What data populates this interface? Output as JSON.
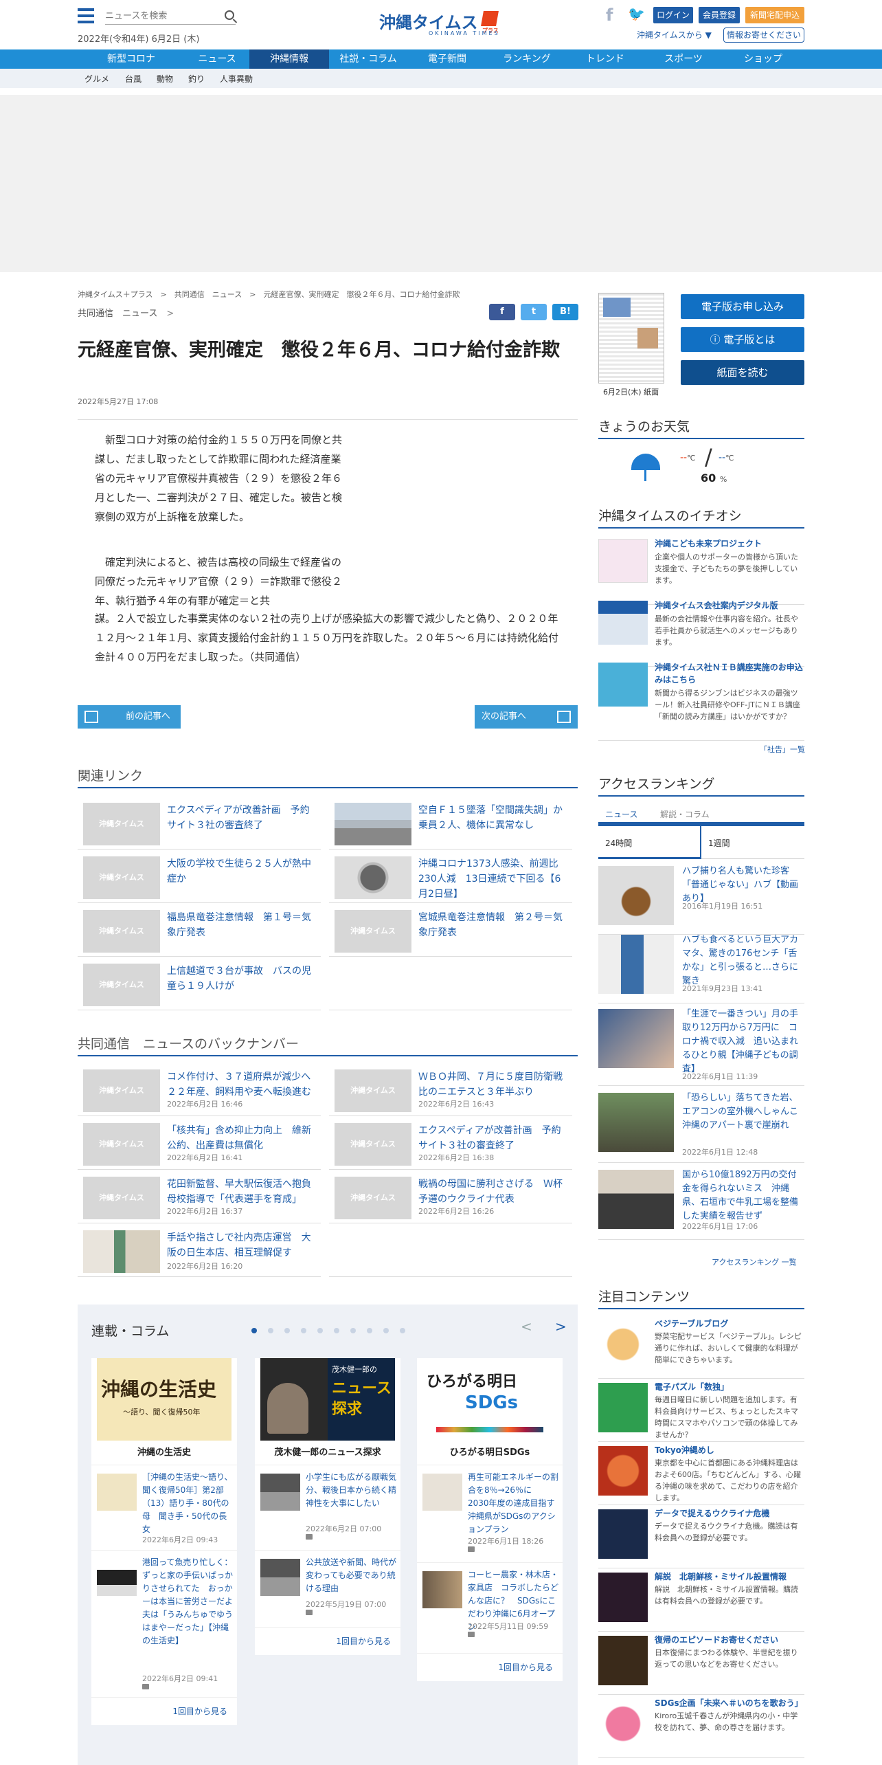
{
  "header": {
    "search_placeholder": "ニュースを検索",
    "date": "2022年(令和4年) 6月2日 (木)",
    "logo_ja": "沖縄タイムス",
    "logo_plus": "プラス",
    "logo_en": "OKINAWA TIMES",
    "login": "ログイン",
    "register": "会員登録",
    "home_delivery": "新聞宅配申込",
    "from_okinawa": "沖縄タイムスから ▼",
    "info_request": "情報お寄せください"
  },
  "nav": [
    "新型コロナ",
    "ニュース",
    "沖縄情報",
    "社説・コラム",
    "電子新聞",
    "ランキング",
    "トレンド",
    "スポーツ",
    "ショップ"
  ],
  "subnav": [
    "グルメ",
    "台風",
    "動物",
    "釣り",
    "人事異動"
  ],
  "breadcrumb": [
    "沖縄タイムス＋プラス",
    "共同通信　ニュース",
    "元経産官僚、実刑確定　懲役２年６月、コロナ給付金詐欺"
  ],
  "category": "共同通信　ニュース",
  "share": {
    "facebook": "f",
    "twitter": "t",
    "hatena": "B!"
  },
  "article": {
    "title": "元経産官僚、実刑確定　懲役２年６月、コロナ給付金詐欺",
    "date": "2022年5月27日 17:08",
    "p1": "新型コロナ対策の給付金約１５５０万円を同僚と共謀し、だまし取ったとして詐欺罪に問われた経済産業省の元キャリア官僚桜井真被告（２９）を懲役２年６月とした一、二審判決が２７日、確定した。被告と検察側の双方が上訴権を放棄した。",
    "p2a": "確定判決によると、被告は高校の同級生で経産省の同僚だった元キャリア官僚（２９）＝詐欺罪で懲役２年、執行猶予４年の有罪が確定＝と共",
    "p2b": "謀。２人で設立した事業実体のない２社の売り上げが感染拡大の影響で減少したと偽り、２０２０年１２月～２１年１月、家賃支援給付金計約１１５０万円を詐取した。２０年５～６月には持続化給付金計４００万円をだまし取った。（共同通信）",
    "prev": "前の記事へ",
    "next": "次の記事へ"
  },
  "related": {
    "heading": "関連リンク",
    "thumb_text": "沖縄タイムス",
    "items": [
      {
        "title": "エクスペディアが改善計画　予約サイト３社の審査終了"
      },
      {
        "title": "空自Ｆ１５墜落「空間識失調」か　乗員２人、機体に異常なし"
      },
      {
        "title": "大阪の学校で生徒ら２５人が熱中症か"
      },
      {
        "title": "沖縄コロナ1373人感染、前週比230人減　13日連続で下回る【6月2日昼】"
      },
      {
        "title": "福島県竜巻注意情報　第１号＝気象庁発表"
      },
      {
        "title": "宮城県竜巻注意情報　第２号＝気象庁発表"
      },
      {
        "title": "上信越道で３台が事故　バスの児童ら１９人けが"
      }
    ]
  },
  "backnumber": {
    "heading": "共同通信　ニュースのバックナンバー",
    "items": [
      {
        "title": "コメ作付け、３７道府県が減少へ　２２年産、飼料用や麦へ転換進む",
        "date": "2022年6月2日 16:46"
      },
      {
        "title": "ＷＢＯ井岡、７月に５度目防衛戦　比のニエテスと３年半ぶり",
        "date": "2022年6月2日 16:43"
      },
      {
        "title": "「核共有」含め抑止力向上　維新公約、出産費は無償化",
        "date": "2022年6月2日 16:41"
      },
      {
        "title": "エクスペディアが改善計画　予約サイト３社の審査終了",
        "date": "2022年6月2日 16:38"
      },
      {
        "title": "花田新監督、早大駅伝復活へ抱負　母校指導で「代表選手を育成」",
        "date": "2022年6月2日 16:37"
      },
      {
        "title": "戦禍の母国に勝利ささげる　Ｗ杯予選のウクライナ代表",
        "date": "2022年6月2日 16:26"
      },
      {
        "title": "手話や指さしで社内売店運営　大阪の日生本店、相互理解促す",
        "date": "2022年6月2日 16:20"
      }
    ]
  },
  "columns": {
    "heading": "連載・コラム",
    "cards": [
      {
        "hero_title": "沖縄の生活史",
        "hero_sub": "〜語り、聞く復帰50年",
        "name": "沖縄の生活史",
        "items": [
          {
            "title": "［沖縄の生活史～語り、聞く復帰50年］第2部（13）語り手・80代の母　聞き手・50代の長女",
            "date": "2022年6月2日 09:43"
          },
          {
            "title": "港回って魚売り忙しく：ずっと家の手伝いばっかりさせられてた　おっかーは本当に苦労さーだよ夫は「うみんちゅでゆう　はまやーだった」【沖縄の生活史】",
            "date": "2022年6月2日 09:41"
          }
        ],
        "more": "1回目から見る"
      },
      {
        "hero_title": "ニュース探求",
        "hero_sub": "茂木健一郎の",
        "name": "茂木健一郎のニュース探求",
        "items": [
          {
            "title": "小学生にも広がる厭戦気分、戦後日本から続く精神性を大事にしたい",
            "date": "2022年6月2日 07:00"
          },
          {
            "title": "公共放送や新聞、時代が変わっても必要であり続ける理由",
            "date": "2022年5月19日 07:00"
          }
        ],
        "more": "1回目から見る"
      },
      {
        "hero_title": "ひろがる明日",
        "hero_sub": "SDGs",
        "name": "ひろがる明日SDGs",
        "items": [
          {
            "title": "再生可能エネルギーの割合を8％→26％に　2030年度の達成目指す　沖縄県がSDGsのアクションプラン",
            "date": "2022年6月1日 18:26"
          },
          {
            "title": "コーヒー農家・林木店・家具店　コラボしたらどんな店に？　SDGsにこだわり沖縄に6月オープン",
            "date": "2022年5月11日 09:59"
          }
        ],
        "more": "1回目から見る"
      }
    ]
  },
  "right": {
    "paper_caption": "6月2日(木) 紙面",
    "btn_apply": "電子版お申し込み",
    "btn_about": "電子版とは",
    "btn_read": "紙面を読む",
    "weather_heading": "きょうのお天気",
    "weather_high": "--",
    "weather_low": "--",
    "weather_unit": "℃",
    "weather_rain": "60",
    "weather_rain_unit": "%",
    "pick_heading": "沖縄タイムスのイチオシ",
    "picks": [
      {
        "title": "沖縄こども未来プロジェクト",
        "desc": "企業や個人のサポーターの皆様から頂いた支援金で、子どもたちの夢を後押ししています。"
      },
      {
        "title": "沖縄タイムス会社案内デジタル版",
        "desc": "最新の会社情報や仕事内容を紹介。社長や若手社員から就活生へのメッセージもあります。"
      },
      {
        "title": "沖縄タイムス社ＮＩＢ講座実施のお申込みはこちら",
        "desc": "新聞から得るジンブンはビジネスの最強ツール！新入社員研修やOFF-JTにＮＩＢ講座「新聞の読み方講座」はいかがですか？"
      }
    ],
    "notice_link": "「社告」一覧",
    "ranking_heading": "アクセスランキング",
    "ranking_tabs": [
      "ニュース",
      "解説・コラム"
    ],
    "ranking_periods": [
      "24時間",
      "1週間"
    ],
    "ranking": [
      {
        "title": "ハブ捕り名人も驚いた珍客「普通じゃない」ハブ【動画あり】",
        "date": "2016年1月19日 16:51"
      },
      {
        "title": "ハブも食べるという巨大アカマタ、驚きの176センチ「舌かな」と引っ張ると…さらに驚き",
        "date": "2021年9月23日 13:41"
      },
      {
        "title": "「生涯で一番きつい」月の手取り12万円から7万円に　コロナ禍で収入減　追い込まれるひとり親【沖縄子どもの調査】",
        "date": "2022年6月1日 11:39"
      },
      {
        "title": "「恐らしい」落ちてきた岩、エアコンの室外機へしゃんこ　沖縄のアパート裏で崖崩れ",
        "date": "2022年6月1日 12:48"
      },
      {
        "title": "国から10億1892万円の交付金を得られないミス　沖縄県、石垣市で牛乳工場を整備した実績を報告せず",
        "date": "2022年6月1日 17:06"
      }
    ],
    "ranking_more": "アクセスランキング 一覧",
    "attention_heading": "注目コンテンツ",
    "attention": [
      {
        "title": "ベジテーブルブログ",
        "desc": "野菜宅配サービス「ベジテーブル」。レシピ通りに作れば、おいしくて健康的な料理が簡単にできちゃいます。"
      },
      {
        "title": "電子パズル「数独」",
        "desc": "毎週日曜日に新しい問題を追加します。有料会員向けサービス、ちょっとしたスキマ時間にスマホやパソコンで頭の体操してみませんか？"
      },
      {
        "title": "Tokyo沖縄めし",
        "desc": "東京都を中心に首都圏にある沖縄料理店はおよそ600店。「ちむどんどん」する、心躍る沖縄の味を求めて、こだわりの店を紹介します。"
      },
      {
        "title": "データで捉えるウクライナ危機",
        "desc": "データで捉えるウクライナ危機。購読は有料会員への登録が必要です。"
      },
      {
        "title": "解説　北朝鮮核・ミサイル設置情報",
        "desc": "解説　北朝鮮核・ミサイル設置情報。購読は有料会員への登録が必要です。"
      },
      {
        "title": "復帰のエピソードお寄せください",
        "desc": "日本復帰にまつわる体験や、半世紀を振り返っての思いなどをお寄せください。"
      },
      {
        "title": "SDGs企画「未来へ＃いのちを歌おう」",
        "desc": "Kiroro玉城千春さんが沖縄県内の小・中学校を訪れて、夢、命の尊さを届けます。"
      }
    ]
  },
  "colors": {
    "brand": "#1f5da8",
    "nav": "#1f8ed6",
    "nav_active": "#17508f",
    "button": "#1170c4",
    "orange": "#f2a03b"
  }
}
